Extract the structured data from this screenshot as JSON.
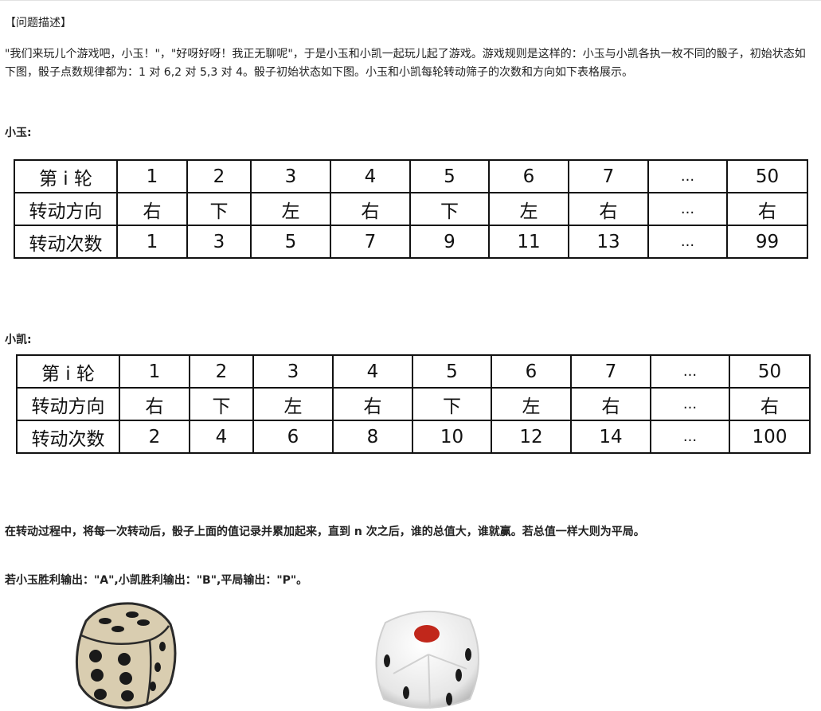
{
  "heading": "【问题描述】",
  "description": "\"我们来玩儿个游戏吧，小玉！\"，\"好呀好呀！我正无聊呢\"，于是小玉和小凯一起玩儿起了游戏。游戏规则是这样的：小玉与小凯各执一枚不同的骰子，初始状态如下图，骰子点数规律都为：1 对 6,2 对 5,3 对 4。骰子初始状态如下图。小玉和小凯每轮转动筛子的次数和方向如下表格展示。",
  "xiaoyu": {
    "label": "小玉:",
    "rows": [
      [
        "第 i 轮",
        "1",
        "2",
        "3",
        "4",
        "5",
        "6",
        "7",
        "...",
        "50"
      ],
      [
        "转动方向",
        "右",
        "下",
        "左",
        "右",
        "下",
        "左",
        "右",
        "...",
        "右"
      ],
      [
        "转动次数",
        "1",
        "3",
        "5",
        "7",
        "9",
        "11",
        "13",
        "...",
        "99"
      ]
    ]
  },
  "xiaokai": {
    "label": "小凯:",
    "rows": [
      [
        "第 i 轮",
        "1",
        "2",
        "3",
        "4",
        "5",
        "6",
        "7",
        "...",
        "50"
      ],
      [
        "转动方向",
        "右",
        "下",
        "左",
        "右",
        "下",
        "左",
        "右",
        "...",
        "右"
      ],
      [
        "转动次数",
        "2",
        "4",
        "6",
        "8",
        "10",
        "12",
        "14",
        "...",
        "100"
      ]
    ]
  },
  "note1": "在转动过程中，将每一次转动后，骰子上面的值记录并累加起来，直到 n 次之后，谁的总值大，谁就赢。若总值一样大则为平局。",
  "note2": "若小玉胜利输出：\"A\",小凯胜利输出：\"B\",平局输出：\"P\"。",
  "colors": {
    "dice1_face": "#d9cdb0",
    "dice2_face": "#eeeeee",
    "dice2_pip": "#c1271b"
  }
}
